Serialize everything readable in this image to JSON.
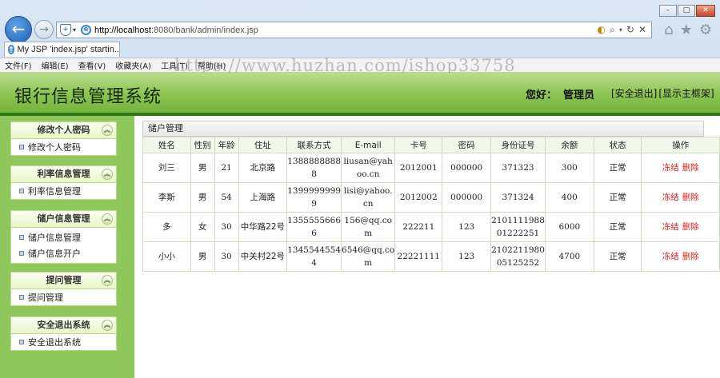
{
  "browser": {
    "url_host": "http://localhost",
    "url_rest": ":8080/bank/admin/index.jsp",
    "tab_title": "My JSP 'index.jsp' startin...",
    "menu": [
      "文件(F)",
      "编辑(E)",
      "查看(V)",
      "收藏夹(A)",
      "工具(T)",
      "帮助(H)"
    ],
    "watermark": "https://www.huzhan.com/ishop33758"
  },
  "header": {
    "title": "银行信息管理系统",
    "greeting": "您好：",
    "user": "管理员",
    "logout_link": "[安全退出]",
    "frame_link": "[显示主框架]"
  },
  "sidebar": {
    "sections": [
      {
        "title": "修改个人密码",
        "items": [
          "修改个人密码"
        ]
      },
      {
        "title": "利率信息管理",
        "items": [
          "利率信息管理"
        ]
      },
      {
        "title": "储户信息管理",
        "items": [
          "储户信息管理",
          "储户信息开户"
        ]
      },
      {
        "title": "提问管理",
        "items": [
          "提问管理"
        ]
      },
      {
        "title": "安全退出系统",
        "items": [
          "安全退出系统"
        ]
      }
    ]
  },
  "main": {
    "panel_title": "储户管理",
    "columns": [
      "姓名",
      "性别",
      "年龄",
      "住址",
      "联系方式",
      "E-mail",
      "卡号",
      "密码",
      "身份证号",
      "余额",
      "状态",
      "操作"
    ],
    "rows": [
      {
        "name": "刘三",
        "sex": "男",
        "age": "21",
        "addr": "北京路",
        "phone": "1388888888 8",
        "email": "liusan@yah oo.cn",
        "card": "2012001",
        "pwd": "000000",
        "idno": "371323",
        "balance": "300",
        "status": "正常"
      },
      {
        "name": "李斯",
        "sex": "男",
        "age": "54",
        "addr": "上海路",
        "phone": "1399999999 9",
        "email": "lisi@yahoo. cn",
        "card": "2012002",
        "pwd": "000000",
        "idno": "371324",
        "balance": "400",
        "status": "正常"
      },
      {
        "name": "多",
        "sex": "女",
        "age": "30",
        "addr": "中华路22号",
        "phone": "1355555666 6",
        "email": "156@qq.co m",
        "card": "222211",
        "pwd": "123",
        "idno": "2101111988 01222251",
        "balance": "6000",
        "status": "正常"
      },
      {
        "name": "小小",
        "sex": "男",
        "age": "30",
        "addr": "中关村22号",
        "phone": "1345544554 4",
        "email": "6546@qq.co m",
        "card": "22221111",
        "pwd": "123",
        "idno": "2102211980 05125252",
        "balance": "4700",
        "status": "正常"
      }
    ],
    "freeze_label": "冻结",
    "delete_label": "删除"
  }
}
